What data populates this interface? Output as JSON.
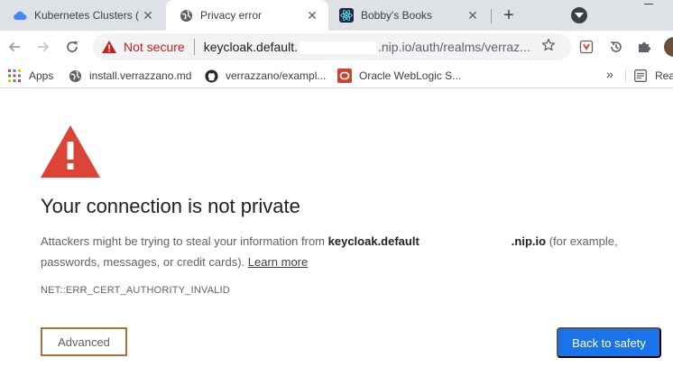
{
  "tabs": [
    {
      "title": "Kubernetes Clusters (",
      "icon": "cloud-icon",
      "active": false
    },
    {
      "title": "Privacy error",
      "icon": "globe-icon",
      "active": true
    },
    {
      "title": "Bobby's Books",
      "icon": "react-icon",
      "active": false
    }
  ],
  "toolbar": {
    "security_label": "Not secure",
    "url_prefix": "keycloak.default.",
    "url_suffix": ".nip.io/auth/realms/verraz..."
  },
  "bookmarks": {
    "items": [
      {
        "label": "Apps",
        "icon": "apps-grid-icon"
      },
      {
        "label": "install.verrazzano.md",
        "icon": "globe-icon"
      },
      {
        "label": "verrazzano/exampl...",
        "icon": "github-icon"
      },
      {
        "label": "Oracle WebLogic S...",
        "icon": "oracle-icon"
      }
    ],
    "more_label": "»",
    "reading_list_label": "Read"
  },
  "interstitial": {
    "heading": "Your connection is not private",
    "text_before_host": "Attackers might be trying to steal your information from ",
    "host_prefix": "keycloak.default",
    "host_suffix": ".nip.io",
    "text_after_host": " (for example, passwords, messages, or credit cards). ",
    "learn_more": "Learn more",
    "error_code": "NET::ERR_CERT_AUTHORITY_INVALID",
    "advanced_label": "Advanced",
    "back_label": "Back to safety"
  },
  "colors": {
    "danger_red": "#db4437",
    "not_secure_red": "#c5221f",
    "primary_blue": "#1a73e8",
    "highlight_outline": "#b36b3a"
  }
}
